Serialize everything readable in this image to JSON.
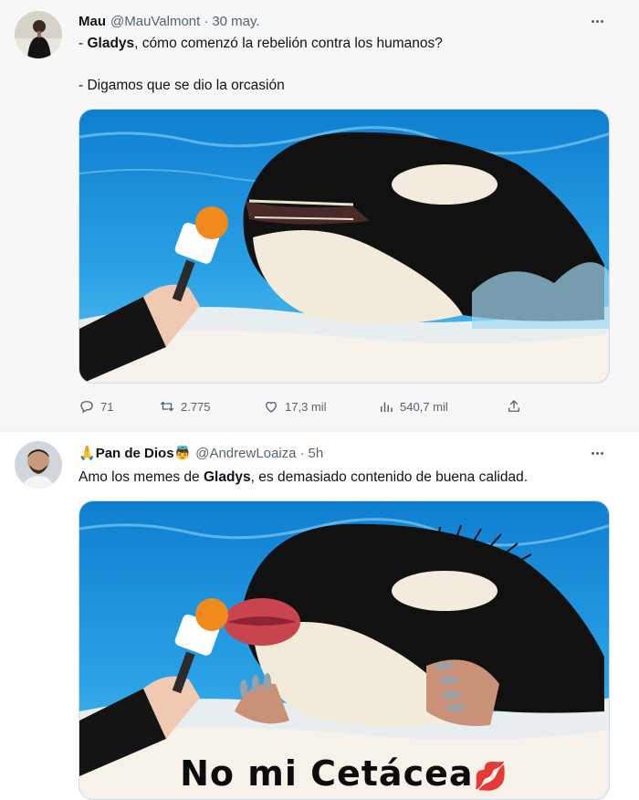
{
  "tweets": [
    {
      "display_name": "Mau",
      "handle": "@MauValmont",
      "separator": "·",
      "time": "30 may.",
      "line1_prefix": "- ",
      "line1_bold": "Gladys",
      "line1_rest": ", cómo comenzó la rebelión contra los humanos?",
      "line2": "- Digamos que se dio la orcasión",
      "stats": {
        "replies": "71",
        "retweets": "2.775",
        "likes": "17,3 mil",
        "views": "540,7 mil"
      }
    },
    {
      "name_emoji_prefix": "🙏",
      "display_name": "Pan de Dios",
      "name_emoji_suffix": "👼",
      "handle": "@AndrewLoaiza",
      "separator": "·",
      "time": "5h",
      "text_prefix": "Amo los memes de ",
      "text_bold": "Gladys",
      "text_rest": ", es demasiado contenido de buena calidad.",
      "image_caption": "No mi Cetácea",
      "caption_emoji": "💋"
    }
  ],
  "icons": {
    "reply": "reply-icon",
    "retweet": "retweet-icon",
    "like": "heart-icon",
    "views": "views-icon",
    "share": "share-icon",
    "more": "more-icon"
  },
  "colors": {
    "text": "#0f1419",
    "secondary": "#536471",
    "water": "#1f8ed6",
    "orca_black": "#121212",
    "orca_white": "#f3ecdc",
    "mic_orange": "#f08a1c"
  }
}
